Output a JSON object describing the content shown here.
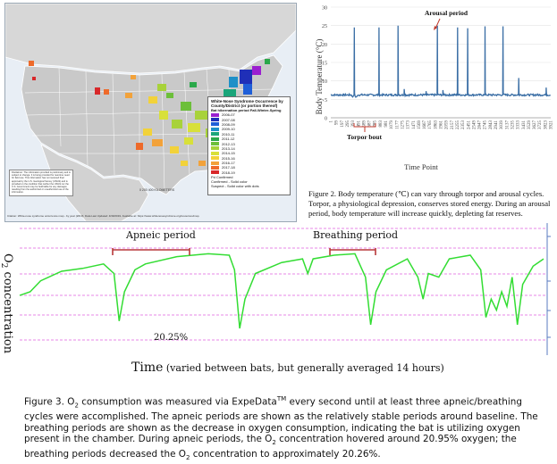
{
  "map": {
    "legend_title": "White-Nose Syndrome Occurrence by County/District (or portion thereof)",
    "legend_subtitle": "Bat hibernation period Fall-Winter-Spring",
    "legend_items": [
      {
        "label": "2006-07",
        "color": "#9b1fd0"
      },
      {
        "label": "2007-08",
        "color": "#1f2fb8"
      },
      {
        "label": "2008-09",
        "color": "#1f5fd8"
      },
      {
        "label": "2009-10",
        "color": "#1e90c8"
      },
      {
        "label": "2010-11",
        "color": "#1aa57a"
      },
      {
        "label": "2011-12",
        "color": "#2aa84a"
      },
      {
        "label": "2012-13",
        "color": "#6cbf3a"
      },
      {
        "label": "2013-14",
        "color": "#a8d23a"
      },
      {
        "label": "2014-15",
        "color": "#d8e03a"
      },
      {
        "label": "2015-16",
        "color": "#f2d23a"
      },
      {
        "label": "2016-17",
        "color": "#f2a23a"
      },
      {
        "label": "2017-18",
        "color": "#ee6a2a"
      },
      {
        "label": "2018-19",
        "color": "#d8282a"
      }
    ],
    "legend_extra": [
      "Pd Confirmed",
      "Confirmed - Solid color",
      "Suspect - Solid color with dots"
    ],
    "note": "Disclaimer: The information provided is preliminary and is subject to change. It is being provided for real-time need for field use. This information has not received final approval by the U.S. Geological Survey (USGS) and is provided on the condition that neither the USGS nor the U.S. Government may be held liable for any damages resulting from the authorized or unauthorized use of the information.",
    "scale_text": "0 200 400 KILOMETERS",
    "citation": "Citation: White-nose syndrome occurrence map - by year (2019). Data Last Updated: 4/30/2019. Available at: https://www.whitenosesyndrome.org/resources/map."
  },
  "temp_chart": {
    "ylabel": "Body Temperature (°C)",
    "xlabel": "Time Point",
    "yticks": [
      "0",
      "5",
      "10",
      "15",
      "20",
      "25",
      "30"
    ],
    "xticks": [
      "1",
      "99",
      "197",
      "295",
      "393",
      "491",
      "589",
      "687",
      "785",
      "883",
      "981",
      "1079",
      "1177",
      "1275",
      "1373",
      "1471",
      "1569",
      "1667",
      "1765",
      "1863",
      "1961",
      "2059",
      "2157",
      "2255",
      "2353",
      "2451",
      "2549",
      "2647",
      "2745",
      "2843",
      "2941",
      "3039",
      "3137",
      "3235",
      "3333",
      "3431",
      "3529",
      "3627",
      "3725",
      "3823",
      "3921"
    ],
    "annotation_arousal": "Arousal period",
    "annotation_torpor": "Torpor bout",
    "caption": "Figure 2. Body temperature (℃) can vary through torpor and arousal cycles. Torpor, a physiological depression, conserves stored energy. During an arousal period, body temperature will increase quickly, depleting fat reserves.",
    "line_color": "#3a6ea5"
  },
  "o2_chart": {
    "ylabel_main": "O",
    "ylabel_sub": "2",
    "ylabel_rest": " concentration",
    "xlabel_main": "Time",
    "xlabel_rest": " (varied between bats, but generally averaged 14 hours)",
    "annotation_apneic": "Apneic period",
    "annotation_breathing": "Breathing period",
    "annotation_min": "20.25%",
    "line_color": "#33dd33",
    "guide_color": "#e060e0",
    "bracket_color": "#b8393a"
  },
  "o2_caption": {
    "p1": "Figure 3. O",
    "sub1": "2",
    "p2": " consumption was measured via ExpeData",
    "sup1": "TM",
    "p3": " every second until at least three apneic/breathing cycles were accomplished. The apneic periods are shown as the relatively stable periods around baseline. The breathing periods are shown as the decrease in oxygen consumption, indicating the bat is utilizing oxygen present in the chamber. During apneic periods, the O",
    "sub2": "2",
    "p4": " concentration hovered around 20.95% oxygen; the breathing periods decreased the O",
    "sub3": "2",
    "p5": " concentration to approximately 20.26%."
  },
  "chart_data": [
    {
      "type": "line",
      "title": "",
      "xlabel": "Time Point",
      "ylabel": "Body Temperature (°C)",
      "ylim": [
        0,
        30
      ],
      "xlim": [
        1,
        3921
      ],
      "grid": true,
      "baseline": 6.2,
      "spikes": [
        {
          "x": 420,
          "y": 24.5
        },
        {
          "x": 860,
          "y": 24.5
        },
        {
          "x": 1200,
          "y": 25.0
        },
        {
          "x": 1310,
          "y": 7.8
        },
        {
          "x": 1700,
          "y": 7.2
        },
        {
          "x": 1900,
          "y": 25.0
        },
        {
          "x": 2000,
          "y": 7.5
        },
        {
          "x": 2260,
          "y": 24.5
        },
        {
          "x": 2440,
          "y": 24.3
        },
        {
          "x": 2750,
          "y": 24.8
        },
        {
          "x": 3070,
          "y": 24.8
        },
        {
          "x": 3350,
          "y": 10.8
        },
        {
          "x": 3840,
          "y": 8.2
        }
      ],
      "series": [
        {
          "name": "",
          "values": []
        }
      ]
    },
    {
      "type": "line",
      "title": "",
      "xlabel": "Time (varied between bats, but generally averaged 14 hours)",
      "ylabel": "O2 concentration",
      "grid": true,
      "note": "relative trace; y in arbitrary units where 0 = baseline (~20.95%) and -1 = 20.25% minimum",
      "series": [
        {
          "name": "",
          "values": [
            {
              "x": 0,
              "y": -0.55
            },
            {
              "x": 2,
              "y": -0.5
            },
            {
              "x": 4,
              "y": -0.35
            },
            {
              "x": 8,
              "y": -0.22
            },
            {
              "x": 12,
              "y": -0.18
            },
            {
              "x": 16,
              "y": -0.12
            },
            {
              "x": 18,
              "y": -0.25
            },
            {
              "x": 19,
              "y": -0.9
            },
            {
              "x": 20,
              "y": -0.5
            },
            {
              "x": 22,
              "y": -0.2
            },
            {
              "x": 24,
              "y": -0.12
            },
            {
              "x": 30,
              "y": -0.02
            },
            {
              "x": 36,
              "y": 0.02
            },
            {
              "x": 40,
              "y": 0.0
            },
            {
              "x": 41,
              "y": -0.2
            },
            {
              "x": 42,
              "y": -1.0
            },
            {
              "x": 43,
              "y": -0.6
            },
            {
              "x": 45,
              "y": -0.25
            },
            {
              "x": 50,
              "y": -0.1
            },
            {
              "x": 54,
              "y": -0.05
            },
            {
              "x": 55,
              "y": -0.25
            },
            {
              "x": 56,
              "y": -0.05
            },
            {
              "x": 60,
              "y": 0.0
            },
            {
              "x": 64,
              "y": 0.02
            },
            {
              "x": 66,
              "y": -0.3
            },
            {
              "x": 67,
              "y": -0.95
            },
            {
              "x": 68,
              "y": -0.5
            },
            {
              "x": 70,
              "y": -0.2
            },
            {
              "x": 74,
              "y": -0.05
            },
            {
              "x": 76,
              "y": -0.3
            },
            {
              "x": 77,
              "y": -0.6
            },
            {
              "x": 78,
              "y": -0.25
            },
            {
              "x": 80,
              "y": -0.3
            },
            {
              "x": 82,
              "y": -0.05
            },
            {
              "x": 86,
              "y": 0.0
            },
            {
              "x": 88,
              "y": -0.2
            },
            {
              "x": 89,
              "y": -0.85
            },
            {
              "x": 90,
              "y": -0.6
            },
            {
              "x": 91,
              "y": -0.75
            },
            {
              "x": 92,
              "y": -0.5
            },
            {
              "x": 93,
              "y": -0.7
            },
            {
              "x": 94,
              "y": -0.3
            },
            {
              "x": 95,
              "y": -0.95
            },
            {
              "x": 96,
              "y": -0.4
            },
            {
              "x": 98,
              "y": -0.15
            },
            {
              "x": 100,
              "y": -0.05
            }
          ]
        }
      ]
    }
  ]
}
